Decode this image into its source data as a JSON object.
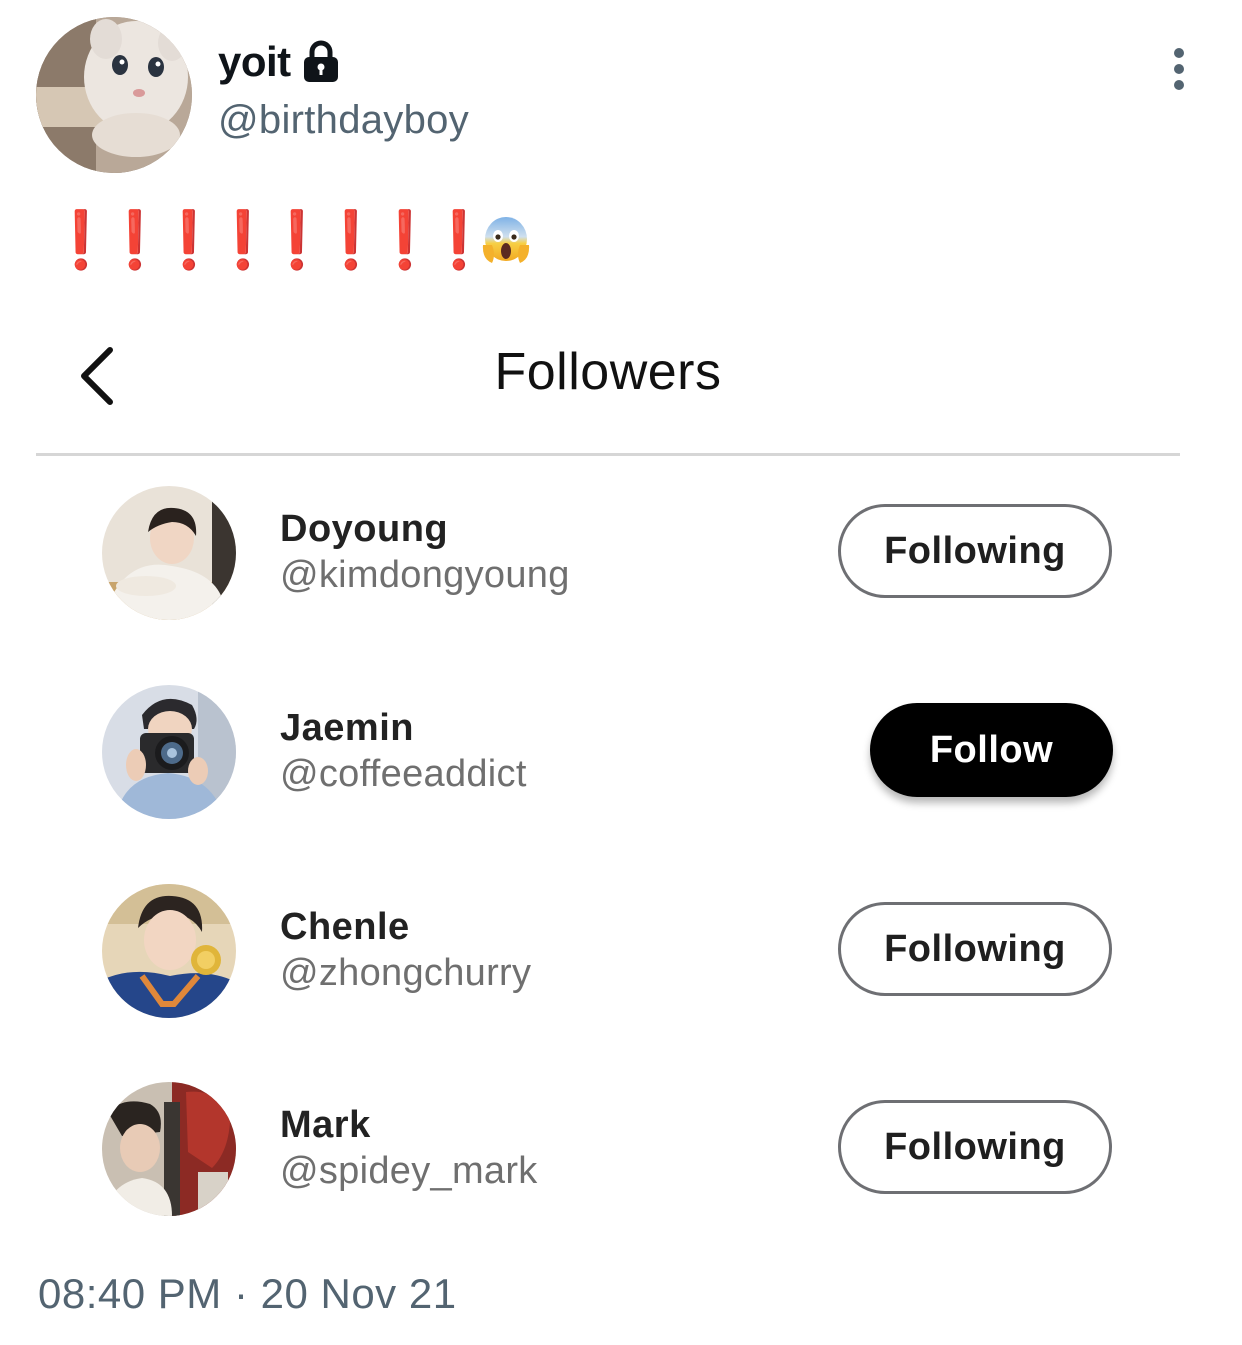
{
  "tweet": {
    "author": {
      "display_name": "yoit",
      "handle": "@birthdayboy",
      "avatar_icon": "cat-avatar",
      "protected_icon": "lock-icon"
    },
    "more_icon": "more-vertical-icon",
    "text": {
      "exclamations": [
        "❗",
        "❗",
        "❗",
        "❗",
        "❗",
        "❗",
        "❗",
        "❗"
      ],
      "emoji": "face-screaming-in-fear-icon"
    },
    "timestamp": "08:40 PM · 20 Nov 21"
  },
  "followers_screen": {
    "back_icon": "chevron-left-icon",
    "title": "Followers",
    "followers": [
      {
        "name": "Doyoung",
        "handle": "@kimdongyoung",
        "button_label": "Following",
        "state": "following"
      },
      {
        "name": "Jaemin",
        "handle": "@coffeeaddict",
        "button_label": "Follow",
        "state": "follow"
      },
      {
        "name": "Chenle",
        "handle": "@zhongchurry",
        "button_label": "Following",
        "state": "following"
      },
      {
        "name": "Mark",
        "handle": "@spidey_mark",
        "button_label": "Following",
        "state": "following"
      }
    ]
  },
  "colors": {
    "exclamation_red": "#e0242b",
    "secondary_text": "#536471",
    "follow_button_bg": "#000000",
    "following_border": "#6e6f73"
  }
}
